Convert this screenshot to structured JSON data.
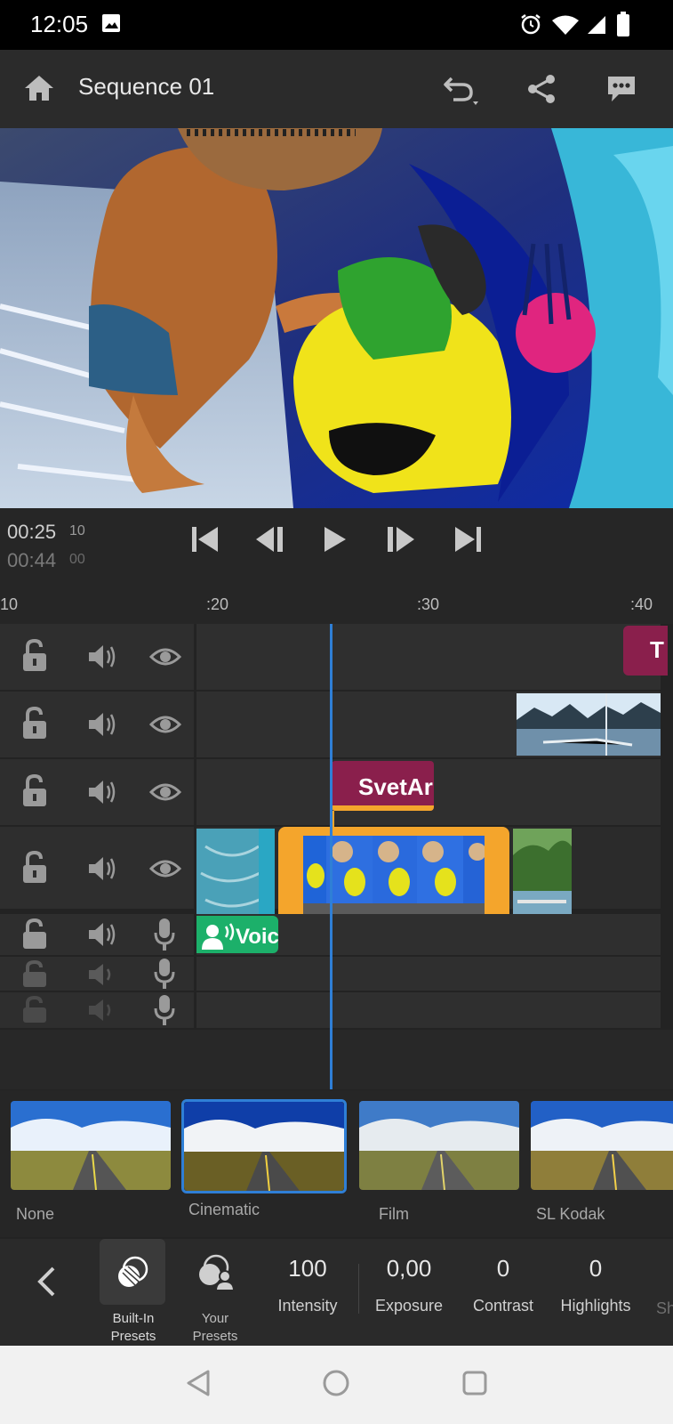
{
  "status_bar": {
    "time": "12:05"
  },
  "header": {
    "title": "Sequence 01"
  },
  "transport": {
    "current_time": "00:25",
    "current_frames": "10",
    "duration_time": "00:44",
    "duration_frames": "00"
  },
  "ruler": {
    "ticks": [
      "10",
      ":20",
      ":30",
      ":40"
    ]
  },
  "clips": {
    "title_clip_1": "T",
    "title_clip_2": "SvetAr",
    "voice_clip": "Voic"
  },
  "looks": [
    {
      "label": "None"
    },
    {
      "label": "Cinematic",
      "selected": true
    },
    {
      "label": "Film"
    },
    {
      "label": "SL Kodak"
    }
  ],
  "toolbar": {
    "built_in_presets_line1": "Built-In",
    "built_in_presets_line2": "Presets",
    "your_presets_line1": "Your",
    "your_presets_line2": "Presets",
    "intensity_value": "100",
    "intensity_label": "Intensity",
    "exposure_value": "0,00",
    "exposure_label": "Exposure",
    "contrast_value": "0",
    "contrast_label": "Contrast",
    "highlights_value": "0",
    "highlights_label": "Highlights",
    "next_label_partial": "Sh"
  },
  "colors": {
    "accent_blue": "#2f7fd6",
    "clip_selected_orange": "#f4a52c",
    "title_clip_magenta": "#8a1f4c",
    "voice_clip_green": "#1cb06a"
  }
}
